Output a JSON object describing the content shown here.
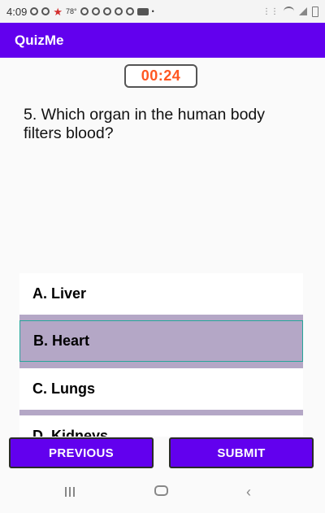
{
  "status_bar": {
    "time": "4:09",
    "temperature": "78°",
    "icons": [
      "notification-icon",
      "notification-icon",
      "star-icon",
      "notification-icon",
      "wifi-icon",
      "signal-icon",
      "battery-icon"
    ]
  },
  "app_bar": {
    "title": "QuizMe"
  },
  "timer": {
    "text": "00:24",
    "color": "#ff5722"
  },
  "question": {
    "text": "5. Which organ in the human body filters blood?"
  },
  "options": [
    {
      "label": "A. Liver",
      "selected": false
    },
    {
      "label": "B. Heart",
      "selected": true
    },
    {
      "label": "C. Lungs",
      "selected": false
    },
    {
      "label": "D. Kidneys",
      "selected": false
    }
  ],
  "buttons": {
    "previous": "PREVIOUS",
    "submit": "SUBMIT"
  },
  "colors": {
    "primary": "#6200ee",
    "selected_option": "#b4a7c6"
  }
}
